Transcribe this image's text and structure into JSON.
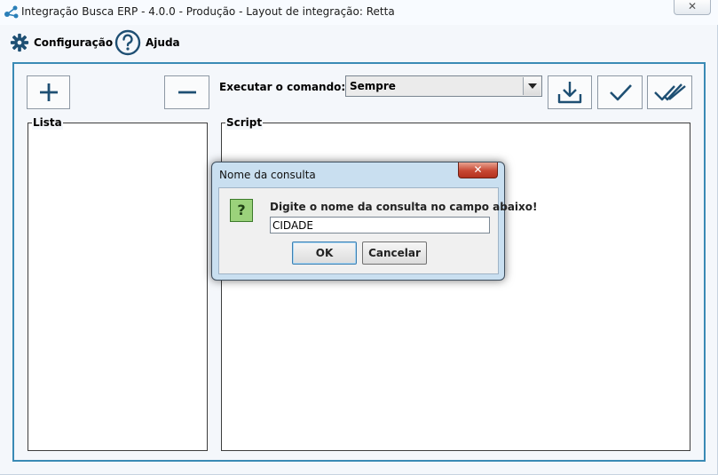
{
  "window": {
    "title": "Integração Busca ERP - 4.0.0 - Produção - Layout de integração: Retta",
    "close_icon": "close-icon"
  },
  "menu": {
    "config_label": "Configuração",
    "config_icon": "gear-icon",
    "help_label": "Ajuda",
    "help_icon": "help-circle-icon"
  },
  "toolbar": {
    "add_icon": "plus-icon",
    "remove_icon": "minus-icon",
    "command_label": "Executar o comando:",
    "command_value": "Sempre",
    "download_icon": "download-icon",
    "check_icon": "check-icon",
    "check_all_icon": "double-check-icon"
  },
  "panels": {
    "list_title": "Lista",
    "script_title": "Script"
  },
  "dialog": {
    "title": "Nome da consulta",
    "message": "Digite o nome da consulta no campo abaixo!",
    "input_value": "CIDADE",
    "ok_label": "OK",
    "cancel_label": "Cancelar",
    "icon": "question-icon",
    "icon_glyph": "?"
  },
  "colors": {
    "accent": "#3a8ab5",
    "icon_blue": "#1e4f73",
    "dialog_close": "#c74733",
    "question_bg": "#9bd27b"
  }
}
